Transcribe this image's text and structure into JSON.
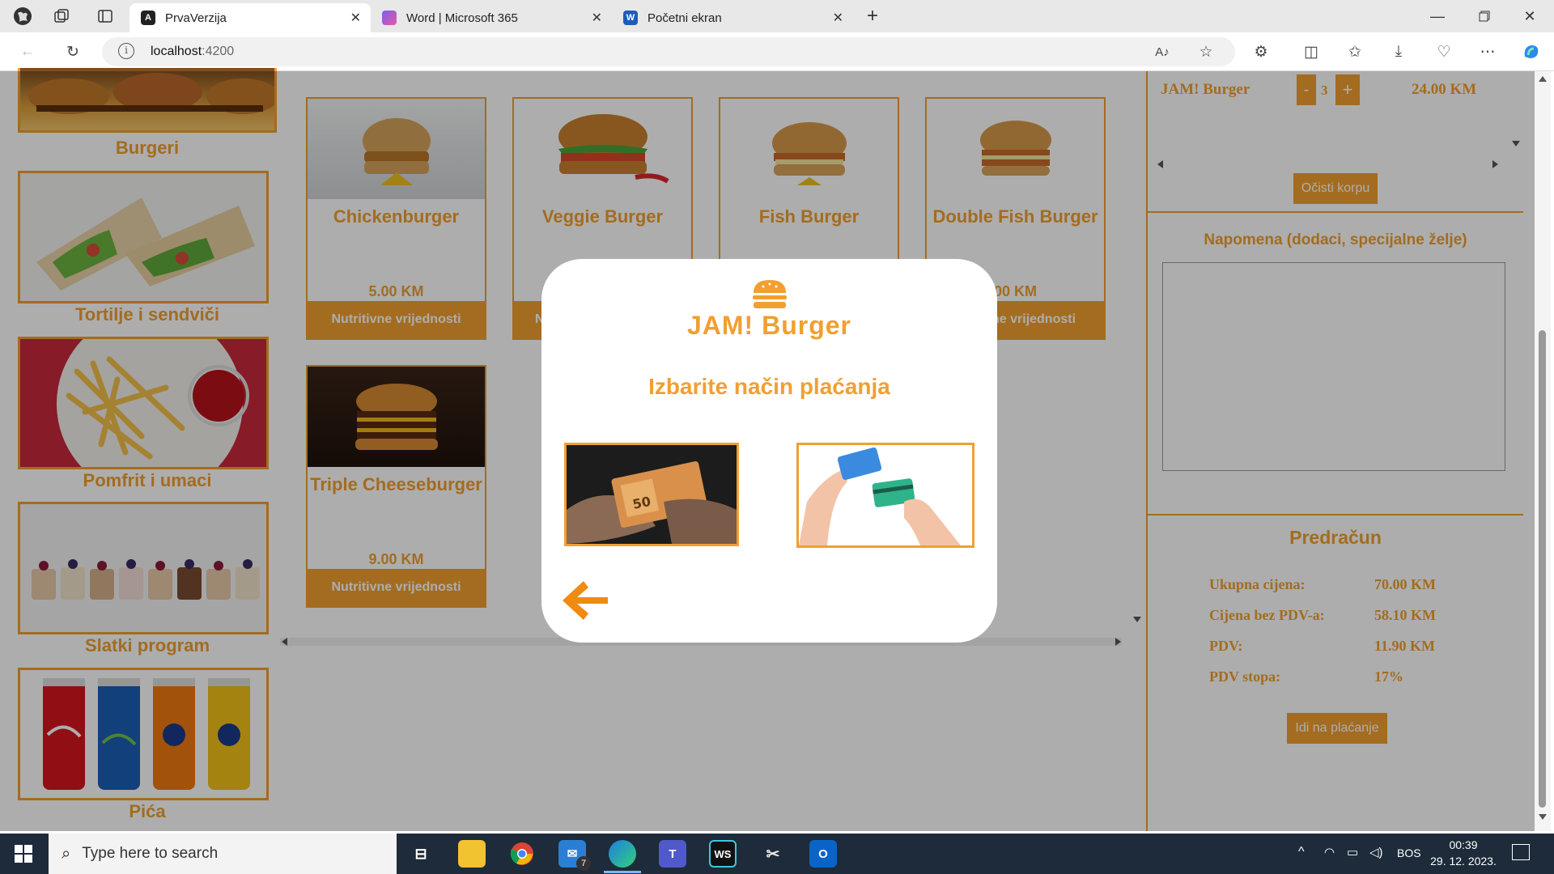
{
  "browser": {
    "tabs": [
      {
        "title": "PrvaVerzija",
        "active": true
      },
      {
        "title": "Word | Microsoft 365",
        "active": false
      },
      {
        "title": "Početni ekran",
        "active": false
      }
    ],
    "url_host": "localhost",
    "url_port": ":4200"
  },
  "categories": [
    {
      "label": "Burgeri"
    },
    {
      "label": "Tortilje i sendviči"
    },
    {
      "label": "Pomfrit i umaci"
    },
    {
      "label": "Slatki program"
    },
    {
      "label": "Pića"
    }
  ],
  "products": [
    {
      "name": "Chickenburger",
      "price": "5.00 KM",
      "button": "Nutritivne vrijednosti"
    },
    {
      "name": "Veggie Burger",
      "price": "",
      "button": "N"
    },
    {
      "name": "Fish Burger",
      "price": "",
      "button": ""
    },
    {
      "name": "Double Fish Burger",
      "price": ".00 KM",
      "button": "ne vrijednosti"
    },
    {
      "name": "Triple Cheeseburger",
      "price": "9.00 KM",
      "button": "Nutritivne vrijednosti"
    }
  ],
  "cart": {
    "item_name": "JAM! Burger",
    "minus": "-",
    "qty": "3",
    "plus": "+",
    "item_price": "24.00 KM",
    "clear_button": "Očisti korpu"
  },
  "note": {
    "title": "Napomena (dodaci, specijalne želje)"
  },
  "invoice": {
    "title": "Predračun",
    "rows": [
      {
        "label": "Ukupna cijena:",
        "value": "70.00 KM"
      },
      {
        "label": "Cijena bez PDV-a:",
        "value": "58.10 KM"
      },
      {
        "label": "PDV:",
        "value": "11.90 KM"
      },
      {
        "label": "PDV stopa:",
        "value": "17%"
      }
    ],
    "pay_button": "Idi na plaćanje"
  },
  "modal": {
    "logo_text": "JAM! Burger",
    "title": "Izbarite način plaćanja"
  },
  "taskbar": {
    "search_placeholder": "Type here to search",
    "mail_badge": "7",
    "lang": "BOS",
    "time": "00:39",
    "date": "29. 12. 2023."
  },
  "colors": {
    "accent": "#f0a030",
    "overlay": "rgba(0,0,0,0.32)",
    "taskbar": "#1d2b3a"
  }
}
